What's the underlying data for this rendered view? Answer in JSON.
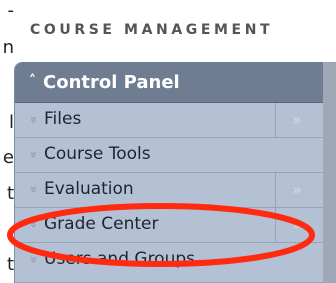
{
  "left_text_fragments": [
    "-",
    "n",
    "l",
    "e",
    "t",
    "t"
  ],
  "header": {
    "title": "COURSE MANAGEMENT"
  },
  "control_panel": {
    "title": "Control Panel",
    "toggle_icon": "double-chevron-up-icon",
    "items": [
      {
        "label": "Files",
        "icon": "double-chevron-down-icon",
        "expand_icon": "double-chevron-right-icon"
      },
      {
        "label": "Course Tools",
        "icon": "double-chevron-down-icon",
        "expand_icon": ""
      },
      {
        "label": "Evaluation",
        "icon": "double-chevron-down-icon",
        "expand_icon": "double-chevron-right-icon"
      },
      {
        "label": "Grade Center",
        "icon": "double-chevron-down-icon",
        "expand_icon": "double-chevron-right-icon"
      },
      {
        "label": "Users and Groups",
        "icon": "double-chevron-down-icon",
        "expand_icon": ""
      }
    ]
  },
  "annotation": {
    "target": "Grade Center",
    "color": "#ff2a10"
  },
  "colors": {
    "panel_bg": "#b4c0d3",
    "panel_header_bg": "#6f7d93",
    "panel_text": "#1e2530"
  }
}
